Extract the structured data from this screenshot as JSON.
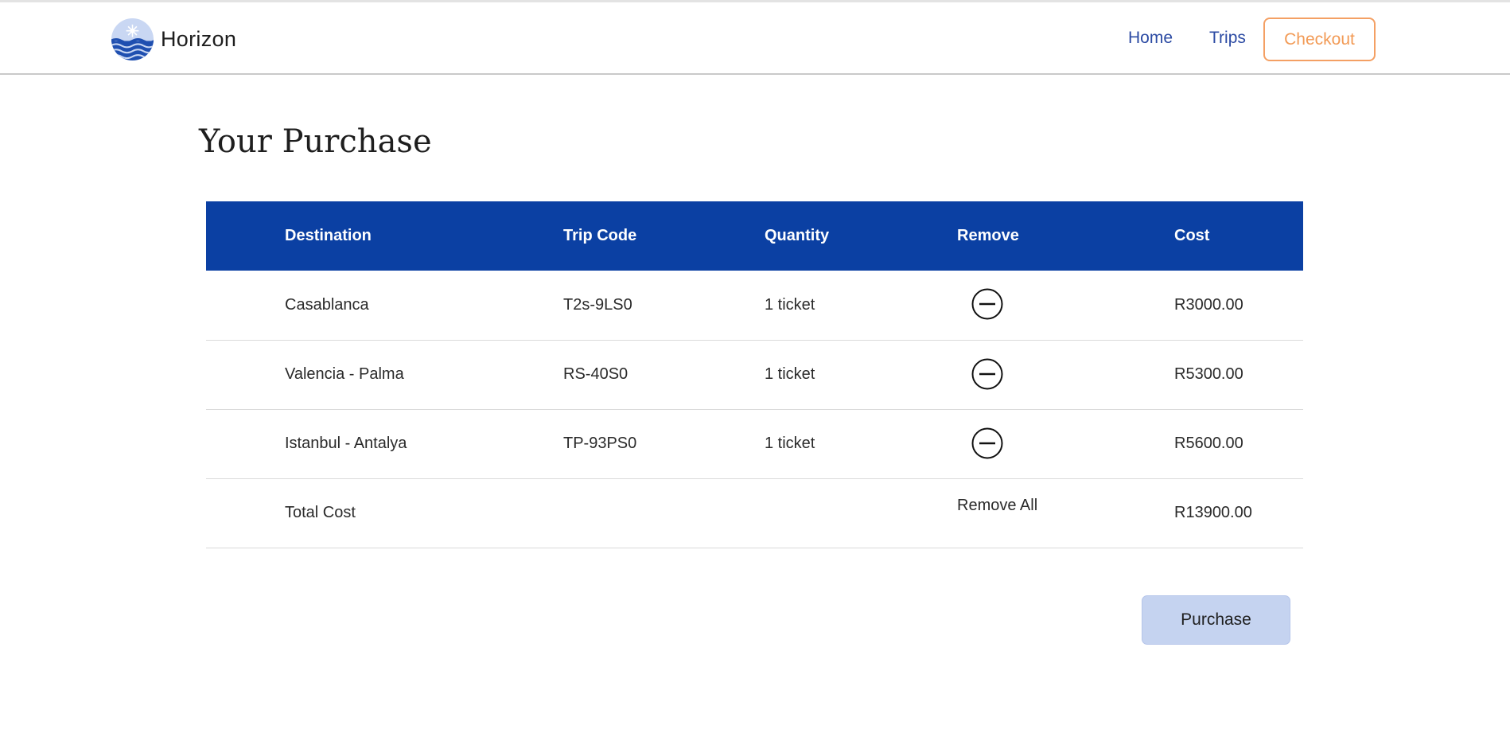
{
  "brand": {
    "name": "Horizon"
  },
  "nav": {
    "home": "Home",
    "trips": "Trips",
    "checkout": "Checkout"
  },
  "page": {
    "title": "Your Purchase"
  },
  "table": {
    "headers": {
      "destination": "Destination",
      "trip_code": "Trip Code",
      "quantity": "Quantity",
      "remove": "Remove",
      "cost": "Cost"
    },
    "rows": [
      {
        "destination": "Casablanca",
        "trip_code": "T2s-9LS0",
        "quantity": "1 ticket",
        "cost": "R3000.00"
      },
      {
        "destination": "Valencia - Palma",
        "trip_code": "RS-40S0",
        "quantity": "1 ticket",
        "cost": "R5300.00"
      },
      {
        "destination": "Istanbul - Antalya",
        "trip_code": "TP-93PS0",
        "quantity": "1 ticket",
        "cost": "R5600.00"
      }
    ],
    "total": {
      "label": "Total Cost",
      "remove_all": "Remove All",
      "cost": "R13900.00"
    }
  },
  "actions": {
    "purchase": "Purchase"
  },
  "colors": {
    "header_bg": "#0b40a3",
    "nav_link": "#2b4aa3",
    "checkout_accent": "#f29a55",
    "purchase_bg": "#c5d3f0"
  },
  "icons": {
    "logo": "sun-over-waves-logo",
    "remove": "minus-circle-icon"
  }
}
